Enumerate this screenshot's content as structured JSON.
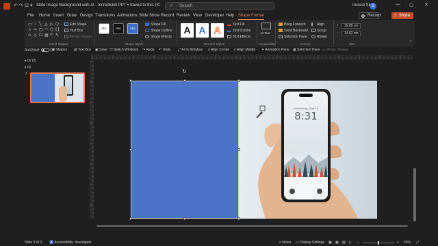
{
  "titlebar": {
    "doc_title": "Slide Image Background with AI - Incrediskill PPT • Saved to this PC",
    "search_placeholder": "Search",
    "user_name": "Incredi Skill",
    "avatar_initial": "IS",
    "qa_items": [
      "↶",
      "↷",
      "⊟",
      "▾"
    ],
    "window_buttons": [
      "—",
      "▢",
      "✕"
    ]
  },
  "menu": {
    "tabs": [
      "File",
      "Home",
      "Insert",
      "Draw",
      "Design",
      "Transitions",
      "Animations",
      "Slide Show",
      "Record",
      "Review",
      "View",
      "Developer",
      "Help",
      "Shape Format"
    ],
    "active_tab": "Shape Format",
    "record_label": "Record",
    "share_label": "Share"
  },
  "ribbon": {
    "insert_shapes": {
      "label": "Insert Shapes",
      "edit_shape": "Edit Shape",
      "text_box": "Text Box",
      "merge_shapes": "Merge Shapes",
      "shapes": [
        "▭",
        "○",
        "╲",
        "△",
        "▷",
        "⬠",
        "☆",
        "⇨",
        "▢",
        "⌒",
        "⬡",
        "{ }",
        "⌓",
        "◇",
        "☐",
        "▤",
        "⬭",
        "✎"
      ]
    },
    "shape_styles": {
      "label": "Shape Styles",
      "swatches": [
        {
          "text": "Abc",
          "bg": "#ffffff",
          "fg": "#222222"
        },
        {
          "text": "Abc",
          "bg": "#111111",
          "fg": "#ffffff"
        },
        {
          "text": "Abc",
          "bg": "#3f6fc4",
          "fg": "#ffffff"
        }
      ],
      "fill": "Shape Fill",
      "outline": "Shape Outline",
      "effects": "Shape Effects"
    },
    "wordart": {
      "label": "WordArt Styles",
      "letters": [
        {
          "text": "A",
          "color": "#111111"
        },
        {
          "text": "A",
          "color": "#3a70cf"
        },
        {
          "text": "A",
          "color": "#f07b3a"
        }
      ],
      "text_fill": "Text Fill",
      "text_outline": "Text Outline",
      "text_effects": "Text Effects"
    },
    "accessibility": {
      "label": "Accessibility",
      "alt_text": "Alt Text"
    },
    "arrange": {
      "label": "Arrange",
      "bring_forward": "Bring Forward",
      "send_backward": "Send Backward",
      "selection_pane": "Selection Pane",
      "align": "Align",
      "group": "Group",
      "rotate": "Rotate"
    },
    "size": {
      "label": "Size",
      "height": "19.05 cm",
      "width": "14.62 cm"
    }
  },
  "qat": {
    "autosave": "AutoSave",
    "autosave_state": "Off",
    "shapes": "Shapes",
    "text_box": "Text Box",
    "save": "Save",
    "switch_windows": "Switch Windows",
    "redo": "Redo",
    "undo": "Undo",
    "fit_to_window": "Fit to Window",
    "align_center": "Align Center",
    "align_middle": "Align Middle",
    "animation_pane": "Animation Pane",
    "selection_pane": "Selection Pane",
    "merge_shapes": "Merge Shapes"
  },
  "thumbnails": {
    "sections": [
      "01 (2)",
      "02"
    ],
    "slide_number": "3"
  },
  "slide": {
    "phone_time": "8:31",
    "phone_date": "Wednesday, May 18"
  },
  "statusbar": {
    "slide_info": "Slide 3 of 3",
    "accessibility": "Accessibility: Investigate",
    "notes": "Notes",
    "display_settings": "Display Settings",
    "zoom": "55%"
  },
  "colors": {
    "accent": "#c4502e",
    "active_tab": "#e5896a",
    "shape_blue": "#4b74c7",
    "background": "#1f1f1f"
  }
}
